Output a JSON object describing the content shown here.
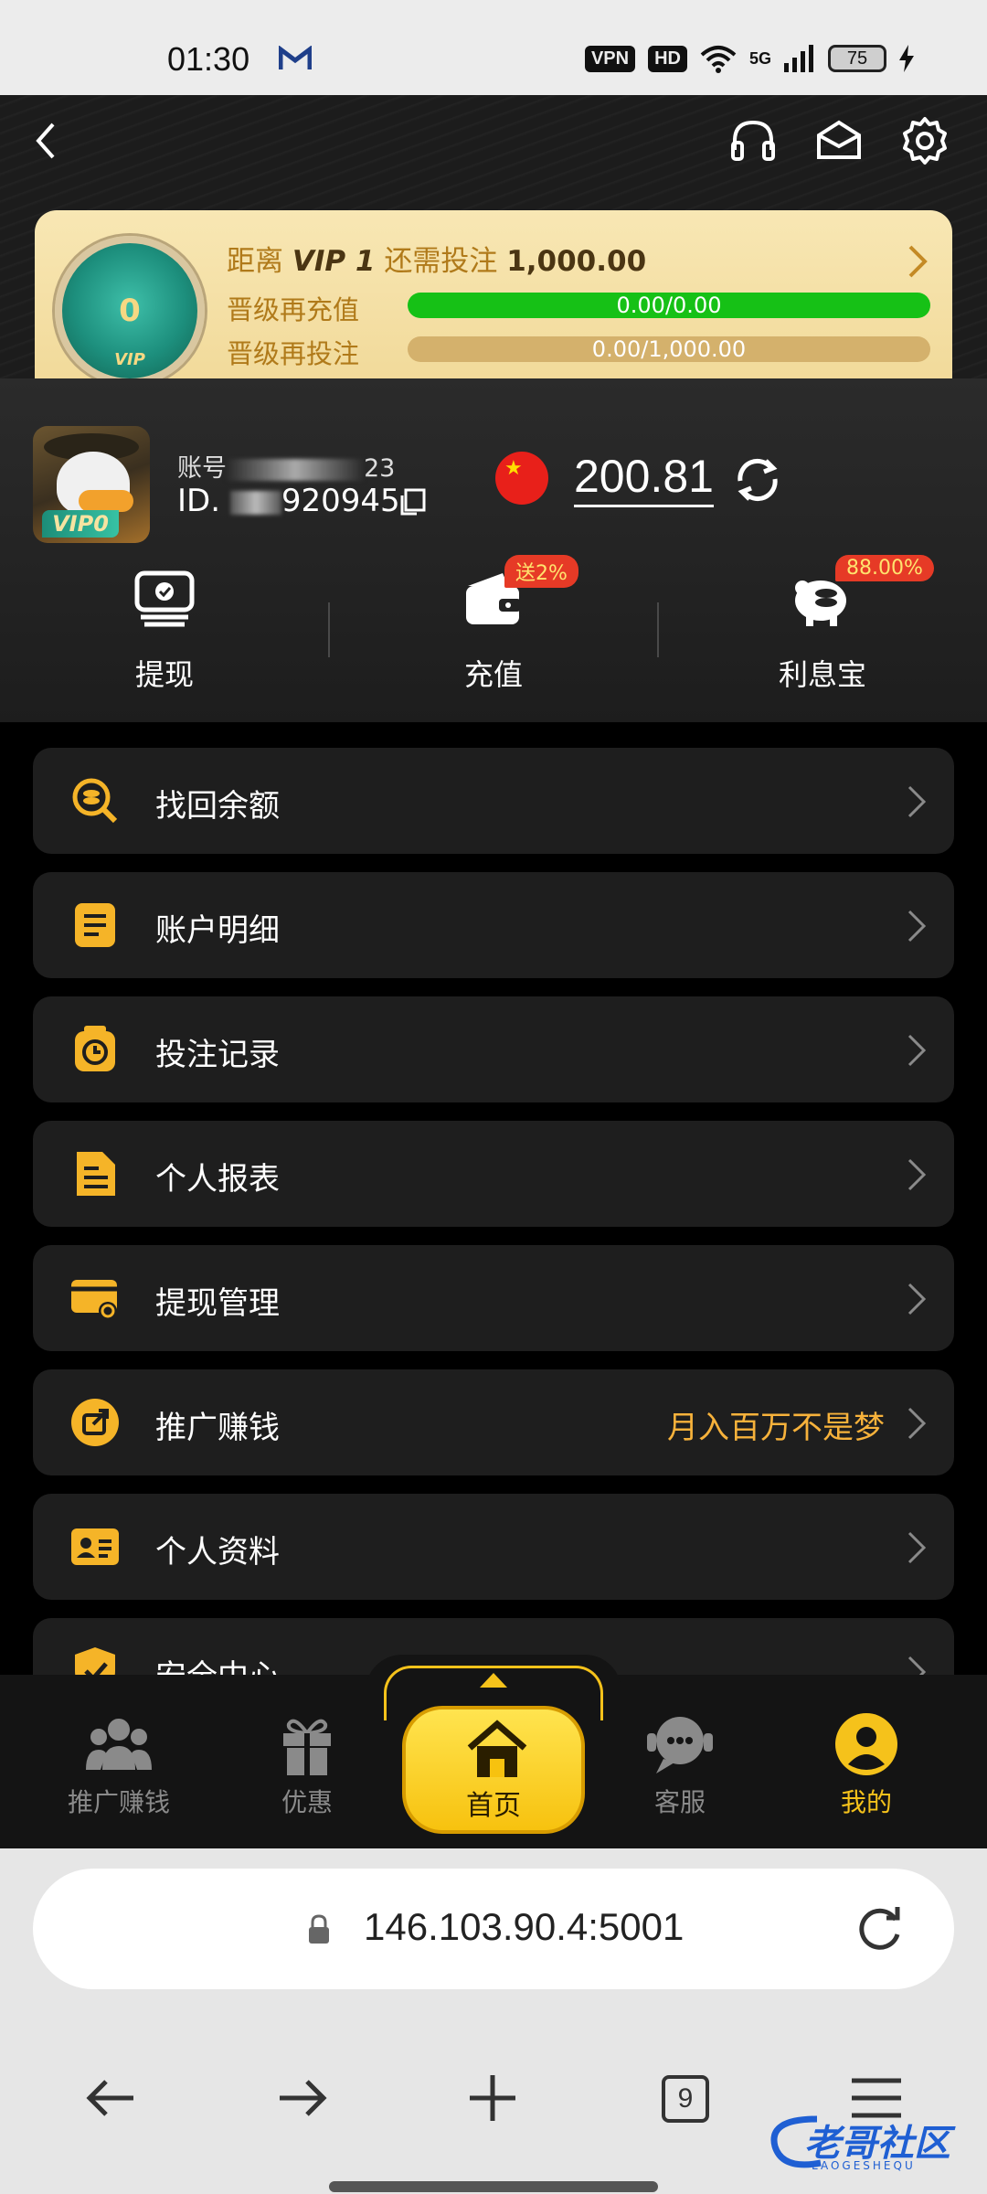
{
  "status_bar": {
    "time": "01:30",
    "vpn_label": "VPN",
    "hd_label": "HD",
    "network_label": "5G",
    "battery": "75"
  },
  "vip": {
    "medal_level": "0",
    "medal_label": "VIP",
    "title_prefix": "距离",
    "title_vip": "VIP 1",
    "title_mid": "还需投注",
    "title_amount": "1,000.00",
    "recharge_label": "晋级再充值",
    "recharge_progress": "0.00/0.00",
    "recharge_fraction": 1.0,
    "bet_label": "晋级再投注",
    "bet_progress": "0.00/1,000.00",
    "bet_fraction": 0.0
  },
  "user": {
    "account_prefix": "账号",
    "account_suffix": "23",
    "id_prefix": "ID. ",
    "id_suffix": "920945",
    "avatar_badge": "VIP0",
    "balance": "200.81"
  },
  "quick_actions": [
    {
      "label": "提现",
      "tag": ""
    },
    {
      "label": "充值",
      "tag": "送2%"
    },
    {
      "label": "利息宝",
      "tag": "88.00%"
    }
  ],
  "menu": [
    {
      "label": "找回余额",
      "right": ""
    },
    {
      "label": "账户明细",
      "right": ""
    },
    {
      "label": "投注记录",
      "right": ""
    },
    {
      "label": "个人报表",
      "right": ""
    },
    {
      "label": "提现管理",
      "right": ""
    },
    {
      "label": "推广赚钱",
      "right": "月入百万不是梦"
    },
    {
      "label": "个人资料",
      "right": ""
    },
    {
      "label": "安全中心",
      "right": ""
    }
  ],
  "bottom_nav": {
    "promote": "推广赚钱",
    "offers": "优惠",
    "home": "首页",
    "service": "客服",
    "mine": "我的"
  },
  "browser": {
    "url": "146.103.90.4:5001",
    "tab_count": "9"
  },
  "watermark": {
    "text": "老哥社区",
    "sub": "LAOGESHEQU"
  },
  "colors": {
    "accent": "#f5c21b",
    "vip_card": "#f4dfa5",
    "progress_green": "#16c116",
    "tag_red": "#e63a26"
  }
}
